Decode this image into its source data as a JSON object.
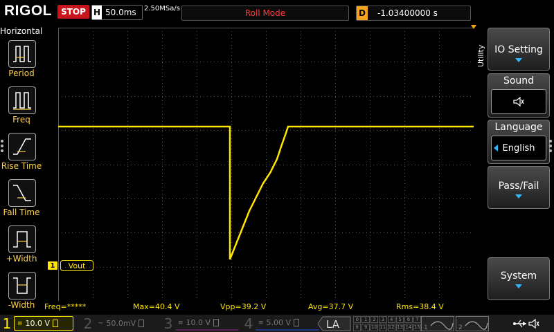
{
  "top": {
    "logo": "RIGOL",
    "status": "STOP",
    "timebase_label": "H",
    "timebase_value": "50.0ms",
    "sample_rate": "2.50MSa/s",
    "mode": "Roll Mode",
    "delay_label": "D",
    "delay_value": "-1.03400000 s"
  },
  "left_menu": {
    "title": "Horizontal",
    "items": [
      {
        "label": "Period"
      },
      {
        "label": "Freq"
      },
      {
        "label": "Rise Time"
      },
      {
        "label": "Fall Time"
      },
      {
        "label": "+Width"
      },
      {
        "label": "-Width"
      }
    ]
  },
  "right_menu": {
    "section": "Utility",
    "items": [
      {
        "label": "IO Setting"
      },
      {
        "label": "Sound"
      },
      {
        "label": "Language",
        "value": "English"
      },
      {
        "label": "Pass/Fail"
      },
      {
        "label": "System"
      }
    ]
  },
  "waveform": {
    "channel_marker": "1",
    "label": "Vout",
    "color": "#ffe600"
  },
  "measurements": {
    "freq": "Freq=*****",
    "max": "Max=40.4 V",
    "vpp": "Vpp=39.2 V",
    "avg": "Avg=37.7 V",
    "rms": "Rms=38.4 V"
  },
  "channels": [
    {
      "num": "1",
      "scale": "10.0 V",
      "color": "#ffe600",
      "active": true
    },
    {
      "num": "2",
      "scale": "50.0mV",
      "color": "#00bcd4",
      "active": false
    },
    {
      "num": "3",
      "scale": "10.0 V",
      "color": "#d020d0",
      "active": false
    },
    {
      "num": "4",
      "scale": "5.00 V",
      "color": "#1e6cff",
      "active": false
    }
  ],
  "la": {
    "label": "LA",
    "bits_top": [
      "0",
      "1",
      "2",
      "3",
      "4",
      "5",
      "6",
      "7"
    ],
    "bits_bottom": [
      "8",
      "9",
      "10",
      "11",
      "12",
      "13",
      "14",
      "15"
    ]
  },
  "trigger_slots": [
    "1",
    "2"
  ],
  "colors": {
    "accent": "#2fb6ff",
    "stop": "#c8141b",
    "delay": "#f7a21b",
    "grid": "#5a5a5a"
  }
}
